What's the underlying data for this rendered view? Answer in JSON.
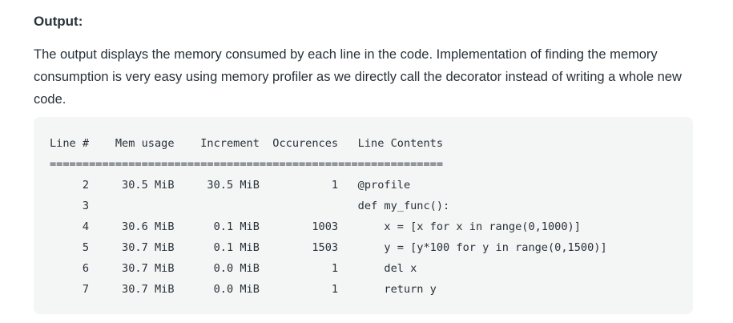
{
  "heading": "Output:",
  "paragraph": "The output displays the memory consumed  by each line in the code. Implementation of finding the memory consumption is very easy using memory profiler as we directly call the decorator instead of writing a whole new code.",
  "code": {
    "header": "Line #    Mem usage    Increment  Occurences   Line Contents",
    "separator": "============================================================",
    "rows": [
      "     2     30.5 MiB     30.5 MiB           1   @profile",
      "     3                                         def my_func():",
      "     4     30.6 MiB      0.1 MiB        1003       x = [x for x in range(0,1000)]",
      "     5     30.7 MiB      0.1 MiB        1503       y = [y*100 for y in range(0,1500)]",
      "     6     30.7 MiB      0.0 MiB           1       del x",
      "     7     30.7 MiB      0.0 MiB           1       return y"
    ]
  }
}
